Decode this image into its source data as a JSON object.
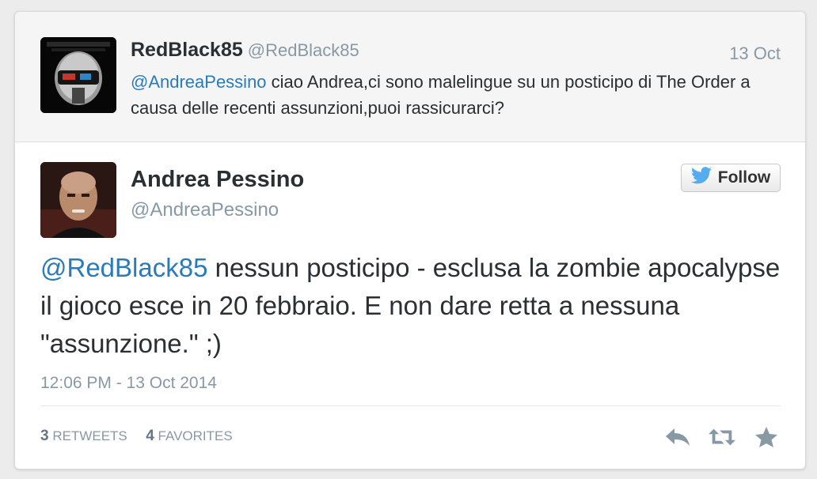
{
  "parent_tweet": {
    "display_name": "RedBlack85",
    "handle": "@RedBlack85",
    "date": "13 Oct",
    "mention": "@AndreaPessino",
    "text": " ciao Andrea,ci sono malelingue su un posticipo di The Order a causa delle recenti assunzioni,puoi rassicurarci?"
  },
  "main_tweet": {
    "display_name": "Andrea Pessino",
    "handle": "@AndreaPessino",
    "follow_label": "Follow",
    "mention": "@RedBlack85",
    "text": " nessun posticipo - esclusa la zombie apocalypse il gioco esce in 20 febbraio. E non dare retta a nessuna \"assunzione.\" ;)",
    "timestamp": "12:06 PM - 13 Oct 2014",
    "retweets_count": "3",
    "retweets_label": "RETWEETS",
    "favorites_count": "4",
    "favorites_label": "FAVORITES"
  },
  "icons": {
    "follow": "twitter-bird-icon",
    "reply": "reply-icon",
    "retweet": "retweet-icon",
    "favorite": "star-icon"
  },
  "colors": {
    "link": "#2b7bb9",
    "muted": "#8899a6",
    "text": "#292f33",
    "twitter_blue": "#55acee"
  }
}
